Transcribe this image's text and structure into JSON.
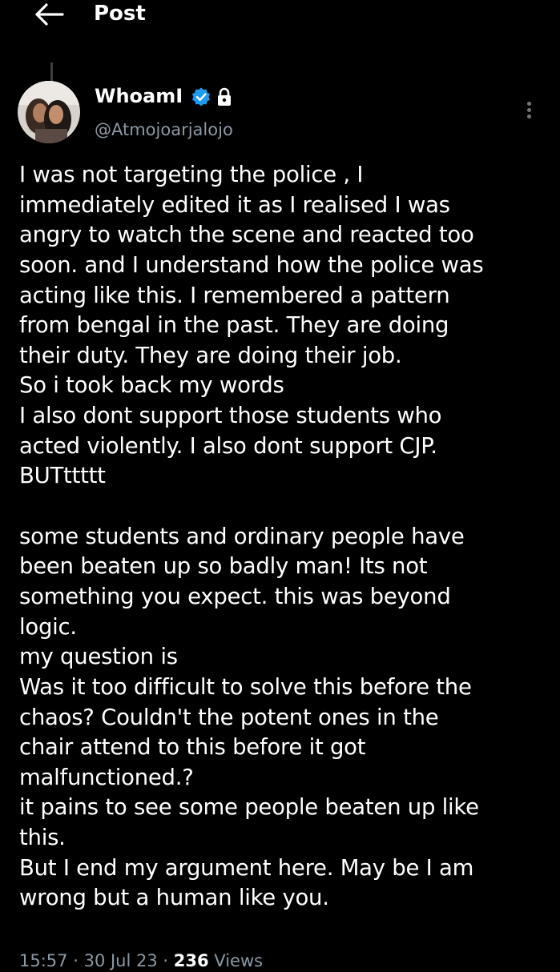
{
  "header": {
    "title": "Post",
    "back_icon": "arrow-left-icon"
  },
  "author": {
    "display_name": "WhoamI",
    "handle": "@Atmojoarjalojo",
    "verified_icon": "verified-badge-icon",
    "protected_icon": "lock-icon",
    "accent_color": "#1d9bf0"
  },
  "post": {
    "lines": [
      "I was not targeting the police , I",
      "immediately edited it as I realised I was",
      "angry to watch the scene and reacted too",
      "soon. and I understand how the police was",
      "acting like this. I remembered a pattern",
      "from bengal in the past. They are doing",
      "their duty. They are doing their job.",
      "So i took back my words",
      "I also dont support those students who",
      "acted violently. I also dont support CJP.",
      "BUTttttt",
      "",
      "some students and ordinary people have",
      "been beaten up so badly man! Its not",
      "something you expect. this was beyond",
      "logic.",
      "my question is",
      "Was it too difficult to solve this before the",
      "chaos? Couldn't the potent ones in the",
      "chair attend to this before it got",
      "malfunctioned.?",
      "it pains to see some people beaten up like",
      "this.",
      "But I end my argument here. May be I am",
      "wrong but a human like you."
    ]
  },
  "meta": {
    "time": "15:57",
    "date": "30 Jul 23",
    "views_count": "236",
    "views_label": "Views"
  }
}
